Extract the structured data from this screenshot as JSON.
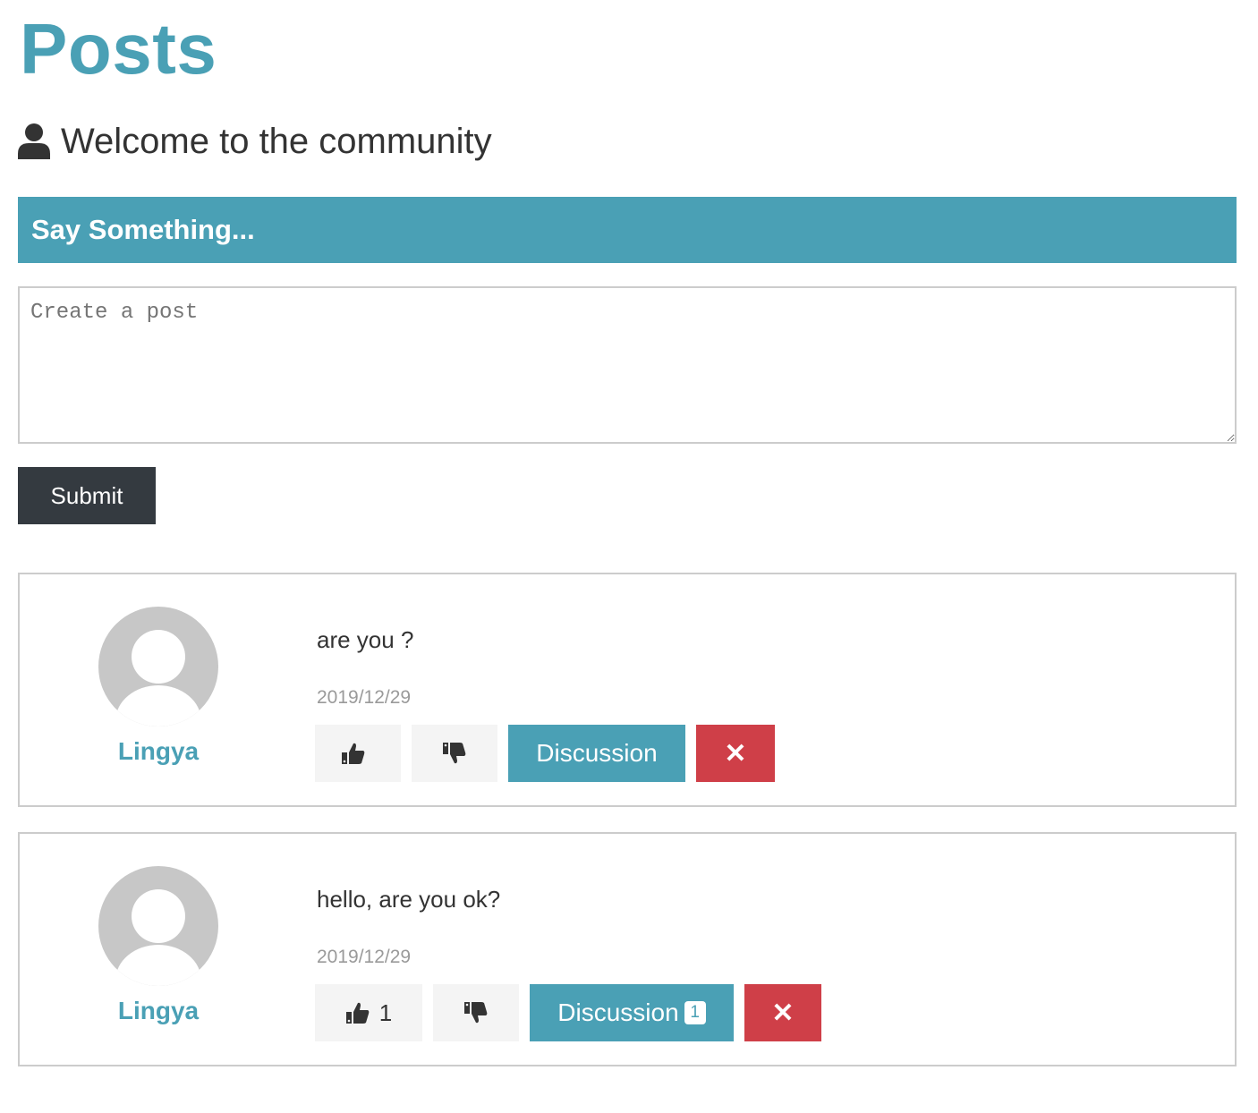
{
  "colors": {
    "primary": "#4aa0b5",
    "danger": "#cf3f48",
    "dark": "#343a40"
  },
  "page_title": "Posts",
  "lead": {
    "icon": "user-icon",
    "text": "Welcome to the community"
  },
  "form": {
    "header": "Say Something...",
    "placeholder": "Create a post",
    "value": "",
    "submit_label": "Submit"
  },
  "posts": [
    {
      "author": "Lingya",
      "text": "are you ?",
      "date": "2019/12/29",
      "likes": "",
      "discussion_label": "Discussion",
      "comment_count": "",
      "delete_label": "✕"
    },
    {
      "author": "Lingya",
      "text": "hello, are you ok?",
      "date": "2019/12/29",
      "likes": "1",
      "discussion_label": "Discussion",
      "comment_count": "1",
      "delete_label": "✕"
    }
  ]
}
